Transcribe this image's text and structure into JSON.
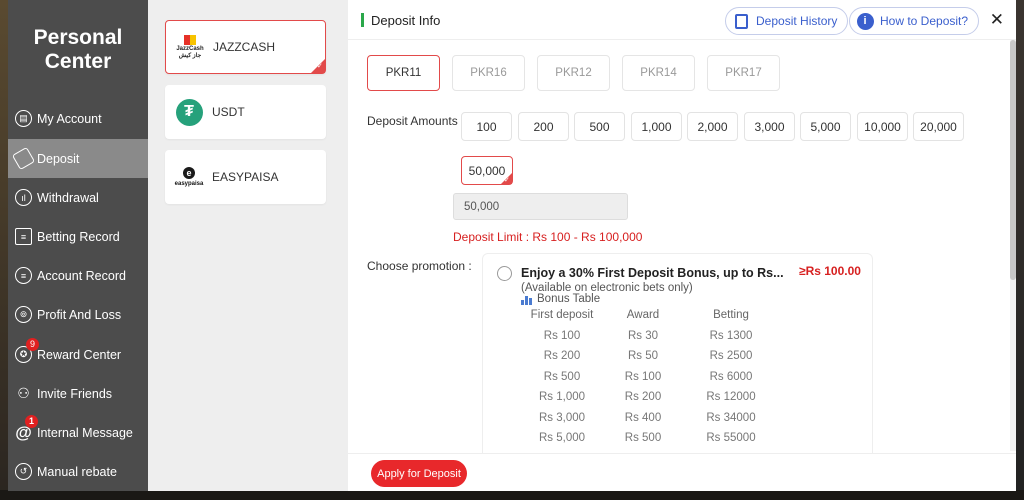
{
  "sidebar": {
    "title_line1": "Personal",
    "title_line2": "Center",
    "items": [
      {
        "label": "My Account"
      },
      {
        "label": "Deposit"
      },
      {
        "label": "Withdrawal"
      },
      {
        "label": "Betting Record"
      },
      {
        "label": "Account Record"
      },
      {
        "label": "Profit And Loss"
      },
      {
        "label": "Reward Center",
        "badge": "9"
      },
      {
        "label": "Invite Friends"
      },
      {
        "label": "Internal Message",
        "badge": "1"
      },
      {
        "label": "Manual rebate"
      }
    ]
  },
  "methods": [
    {
      "label": "JAZZCASH",
      "logo_text": "JazzCash",
      "logo_sub": "جاز کیش"
    },
    {
      "label": "USDT",
      "logo_text": "₮"
    },
    {
      "label": "EASYPAISA",
      "logo_text": "easypaisa",
      "logo_mark": "e"
    }
  ],
  "header": {
    "title": "Deposit Info",
    "history_button": "Deposit History",
    "how_button": "How to Deposit?",
    "close": "✕"
  },
  "currencies": [
    "PKR11",
    "PKR16",
    "PKR12",
    "PKR14",
    "PKR17"
  ],
  "deposit": {
    "label": "Deposit Amounts :",
    "amounts": [
      "100",
      "200",
      "500",
      "1,000",
      "2,000",
      "3,000",
      "5,000",
      "10,000",
      "20,000",
      "50,000"
    ],
    "input_value": "50,000",
    "limit_text": "Deposit Limit : Rs  100  - Rs  100,000"
  },
  "promotion": {
    "label": "Choose promotion :",
    "title": "Enjoy a 30% First Deposit Bonus, up to Rs...",
    "amount": "≥Rs  100.00",
    "subtitle": "(Available on electronic bets only)",
    "table_label": "Bonus Table",
    "columns": [
      "First deposit",
      "Award",
      "Betting"
    ],
    "rows": [
      [
        "Rs 100",
        "Rs 30",
        "Rs 1300"
      ],
      [
        "Rs 200",
        "Rs 50",
        "Rs 2500"
      ],
      [
        "Rs 500",
        "Rs 100",
        "Rs 6000"
      ],
      [
        "Rs 1,000",
        "Rs 200",
        "Rs 12000"
      ],
      [
        "Rs 3,000",
        "Rs 400",
        "Rs 34000"
      ],
      [
        "Rs 5,000",
        "Rs 500",
        "Rs 55000"
      ]
    ]
  },
  "apply_label": "Apply for Deposit",
  "colors": {
    "accent": "#e24a4a",
    "link": "#3a5fcd",
    "sidebar": "#4c4c4c"
  }
}
